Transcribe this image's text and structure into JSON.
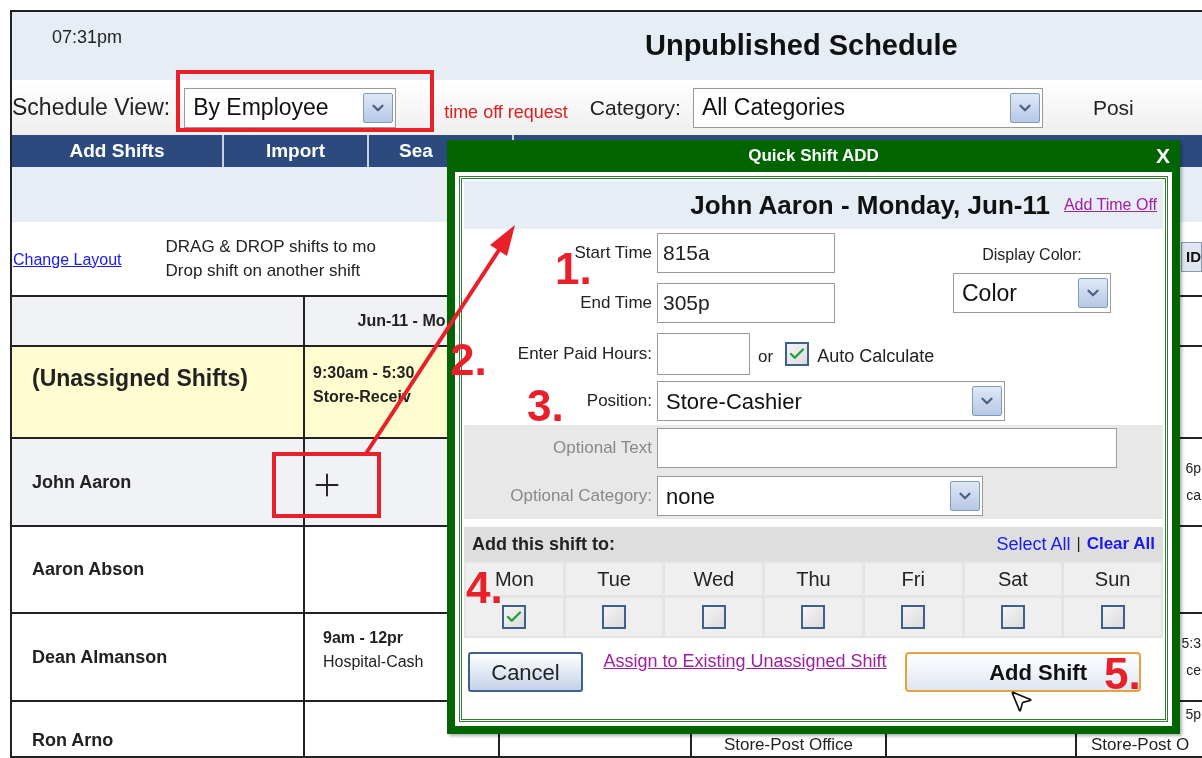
{
  "header": {
    "time": "07:31pm",
    "title": "Unpublished Schedule"
  },
  "filters": {
    "schedule_view": {
      "label": "Schedule View:",
      "value": "By Employee"
    },
    "notice": "time off request",
    "category": {
      "label": "Category:",
      "value": "All Categories"
    },
    "position_label": "Posi"
  },
  "nav": [
    "Add Shifts",
    "Import",
    "Sea"
  ],
  "change_layout": "Change Layout",
  "instructions": [
    "DRAG & DROP shifts to mo",
    "Drop shift on another shift"
  ],
  "side_button": "ID",
  "table": {
    "column": "Jun-11 - Mo",
    "rows": [
      {
        "name": "(Unassigned Shifts)",
        "kind": "unassigned",
        "highlighted": false,
        "shift": [
          "9:30am - 5:30",
          "Store-Receiv"
        ],
        "last": []
      },
      {
        "name": "John Aaron",
        "kind": "employee",
        "highlighted": true,
        "shift": [],
        "last": [
          "6p",
          "ca"
        ]
      },
      {
        "name": "Aaron Abson",
        "kind": "employee",
        "highlighted": false,
        "shift": [],
        "last": []
      },
      {
        "name": "Dean Almanson",
        "kind": "employee",
        "highlighted": false,
        "shift": [
          "9am - 12pr",
          "Hospital-Cash"
        ],
        "last": [
          "5:3",
          "ce"
        ]
      },
      {
        "name": "Ron Arno",
        "kind": "employee",
        "highlighted": false,
        "shift": [],
        "mid": "Store-Post Office",
        "last": [
          "5p",
          "Store-Post O"
        ]
      }
    ]
  },
  "dialog": {
    "title": "Quick Shift ADD",
    "close": "X",
    "heading": "John Aaron - Monday, Jun-11",
    "add_time_off": "Add Time Off",
    "start_time": {
      "label": "Start Time",
      "value": "815a"
    },
    "end_time": {
      "label": "End Time",
      "value": "305p"
    },
    "display_color": {
      "label": "Display Color:",
      "value": "Color"
    },
    "paid_hours": {
      "label": "Enter Paid Hours:",
      "or": "or",
      "auto_label": "Auto Calculate",
      "auto_checked": true
    },
    "position": {
      "label": "Position:",
      "value": "Store-Cashier"
    },
    "optional_text": {
      "label": "Optional Text"
    },
    "optional_category": {
      "label": "Optional Category:",
      "value": "none"
    },
    "add_to": "Add this shift to:",
    "select_all": "Select All",
    "separator": "|",
    "clear_all": "Clear All",
    "days": [
      {
        "label": "Mon",
        "checked": true
      },
      {
        "label": "Tue",
        "checked": false
      },
      {
        "label": "Wed",
        "checked": false
      },
      {
        "label": "Thu",
        "checked": false
      },
      {
        "label": "Fri",
        "checked": false
      },
      {
        "label": "Sat",
        "checked": false
      },
      {
        "label": "Sun",
        "checked": false
      }
    ],
    "cancel": "Cancel",
    "assign_link": "Assign to Existing Unassigned Shift",
    "add_shift": "Add Shift"
  },
  "annotations": {
    "steps": [
      "1.",
      "2.",
      "3.",
      "4.",
      "5."
    ]
  }
}
